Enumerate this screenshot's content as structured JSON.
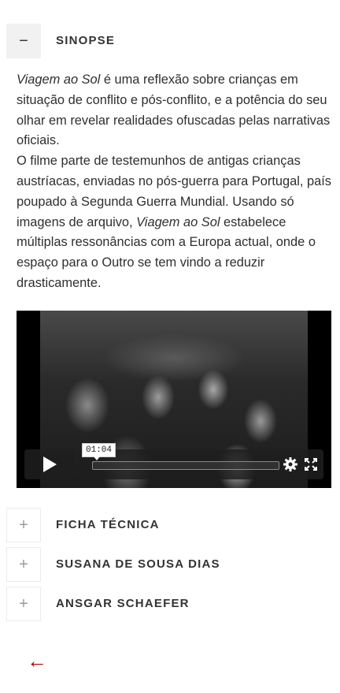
{
  "accordion": {
    "sinopse": {
      "title": "SINOPSE",
      "toggle": "−"
    },
    "ficha": {
      "title": "FICHA TÉCNICA",
      "toggle": "+"
    },
    "susana": {
      "title": "SUSANA DE SOUSA DIAS",
      "toggle": "+"
    },
    "ansgar": {
      "title": "ANSGAR SCHAEFER",
      "toggle": "+"
    }
  },
  "synopsis": {
    "p1_title": "Viagem ao Sol",
    "p1_text": " é uma reflexão sobre crianças em situação de conflito e pós-conflito, e a potência do seu olhar em revelar realidades ofuscadas pelas narrativas oficiais.",
    "p2_text_a": "O filme parte de testemunhos de antigas crianças austríacas, enviadas no pós-guerra para Portugal, país poupado à Segunda Guerra Mundial. Usando só imagens de arquivo, ",
    "p2_title": "Viagem ao Sol",
    "p2_text_b": " estabelece múltiplas ressonâncias com a Europa actual, onde o espaço para o Outro se tem vindo a reduzir drasticamente."
  },
  "video": {
    "time_tooltip": "01:04",
    "icons": [
      "play-icon",
      "settings-icon",
      "fullscreen-icon"
    ]
  },
  "nav": {
    "back_arrow": "←"
  },
  "colors": {
    "accent": "#b00000",
    "toggle_open_bg": "#f1f1f1"
  }
}
